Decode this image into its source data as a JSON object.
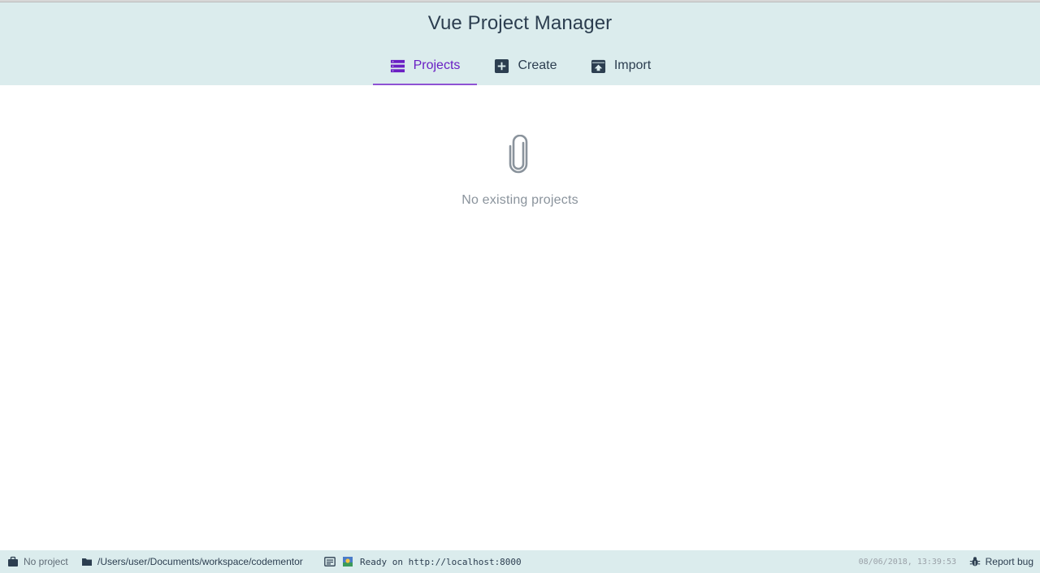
{
  "app": {
    "title": "Vue Project Manager"
  },
  "tabs": [
    {
      "label": "Projects",
      "icon": "list-icon",
      "active": true
    },
    {
      "label": "Create",
      "icon": "add-box-icon",
      "active": false
    },
    {
      "label": "Import",
      "icon": "unarchive-icon",
      "active": false
    }
  ],
  "empty_state": {
    "icon": "attachment-icon",
    "message": "No existing projects"
  },
  "statusbar": {
    "project": "No project",
    "path": "/Users/user/Documents/workspace/codementor",
    "log_message": "Ready on http://localhost:8000",
    "timestamp": "08/06/2018, 13:39:53",
    "report_bug": "Report bug"
  },
  "colors": {
    "header_bg": "#dbeced",
    "accent": "#6a1fc4",
    "text": "#2c3e50",
    "muted": "#8a939c"
  }
}
